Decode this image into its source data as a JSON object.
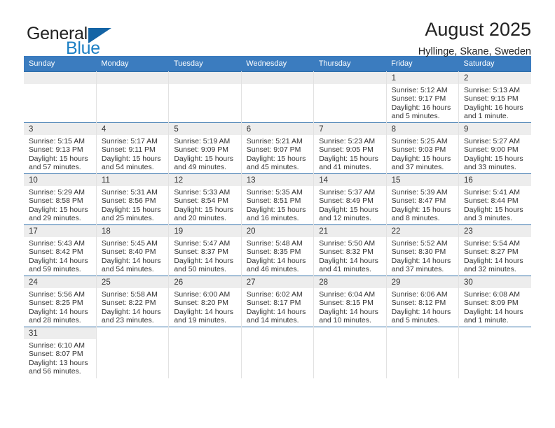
{
  "brand": {
    "name_top": "General",
    "name_bottom": "Blue",
    "triangle_color": "#1464a5",
    "blue_color": "#1c7fc4"
  },
  "header": {
    "title": "August 2025",
    "subtitle": "Hyllinge, Skane, Sweden"
  },
  "theme": {
    "header_blue": "#3b7cbf",
    "row_rule_blue": "#2f6ea8",
    "daynum_band": "#ededed"
  },
  "weekdays": [
    "Sunday",
    "Monday",
    "Tuesday",
    "Wednesday",
    "Thursday",
    "Friday",
    "Saturday"
  ],
  "labels": {
    "sunrise_prefix": "Sunrise:",
    "sunset_prefix": "Sunset:",
    "daylight_prefix": "Daylight:"
  },
  "weeks": [
    [
      {
        "day": "",
        "empty": true
      },
      {
        "day": "",
        "empty": true
      },
      {
        "day": "",
        "empty": true
      },
      {
        "day": "",
        "empty": true
      },
      {
        "day": "",
        "empty": true
      },
      {
        "day": "1",
        "sunrise": "Sunrise: 5:12 AM",
        "sunset": "Sunset: 9:17 PM",
        "daylight_line1": "Daylight: 16 hours",
        "daylight_line2": "and 5 minutes."
      },
      {
        "day": "2",
        "sunrise": "Sunrise: 5:13 AM",
        "sunset": "Sunset: 9:15 PM",
        "daylight_line1": "Daylight: 16 hours",
        "daylight_line2": "and 1 minute."
      }
    ],
    [
      {
        "day": "3",
        "sunrise": "Sunrise: 5:15 AM",
        "sunset": "Sunset: 9:13 PM",
        "daylight_line1": "Daylight: 15 hours",
        "daylight_line2": "and 57 minutes."
      },
      {
        "day": "4",
        "sunrise": "Sunrise: 5:17 AM",
        "sunset": "Sunset: 9:11 PM",
        "daylight_line1": "Daylight: 15 hours",
        "daylight_line2": "and 54 minutes."
      },
      {
        "day": "5",
        "sunrise": "Sunrise: 5:19 AM",
        "sunset": "Sunset: 9:09 PM",
        "daylight_line1": "Daylight: 15 hours",
        "daylight_line2": "and 49 minutes."
      },
      {
        "day": "6",
        "sunrise": "Sunrise: 5:21 AM",
        "sunset": "Sunset: 9:07 PM",
        "daylight_line1": "Daylight: 15 hours",
        "daylight_line2": "and 45 minutes."
      },
      {
        "day": "7",
        "sunrise": "Sunrise: 5:23 AM",
        "sunset": "Sunset: 9:05 PM",
        "daylight_line1": "Daylight: 15 hours",
        "daylight_line2": "and 41 minutes."
      },
      {
        "day": "8",
        "sunrise": "Sunrise: 5:25 AM",
        "sunset": "Sunset: 9:03 PM",
        "daylight_line1": "Daylight: 15 hours",
        "daylight_line2": "and 37 minutes."
      },
      {
        "day": "9",
        "sunrise": "Sunrise: 5:27 AM",
        "sunset": "Sunset: 9:00 PM",
        "daylight_line1": "Daylight: 15 hours",
        "daylight_line2": "and 33 minutes."
      }
    ],
    [
      {
        "day": "10",
        "sunrise": "Sunrise: 5:29 AM",
        "sunset": "Sunset: 8:58 PM",
        "daylight_line1": "Daylight: 15 hours",
        "daylight_line2": "and 29 minutes."
      },
      {
        "day": "11",
        "sunrise": "Sunrise: 5:31 AM",
        "sunset": "Sunset: 8:56 PM",
        "daylight_line1": "Daylight: 15 hours",
        "daylight_line2": "and 25 minutes."
      },
      {
        "day": "12",
        "sunrise": "Sunrise: 5:33 AM",
        "sunset": "Sunset: 8:54 PM",
        "daylight_line1": "Daylight: 15 hours",
        "daylight_line2": "and 20 minutes."
      },
      {
        "day": "13",
        "sunrise": "Sunrise: 5:35 AM",
        "sunset": "Sunset: 8:51 PM",
        "daylight_line1": "Daylight: 15 hours",
        "daylight_line2": "and 16 minutes."
      },
      {
        "day": "14",
        "sunrise": "Sunrise: 5:37 AM",
        "sunset": "Sunset: 8:49 PM",
        "daylight_line1": "Daylight: 15 hours",
        "daylight_line2": "and 12 minutes."
      },
      {
        "day": "15",
        "sunrise": "Sunrise: 5:39 AM",
        "sunset": "Sunset: 8:47 PM",
        "daylight_line1": "Daylight: 15 hours",
        "daylight_line2": "and 8 minutes."
      },
      {
        "day": "16",
        "sunrise": "Sunrise: 5:41 AM",
        "sunset": "Sunset: 8:44 PM",
        "daylight_line1": "Daylight: 15 hours",
        "daylight_line2": "and 3 minutes."
      }
    ],
    [
      {
        "day": "17",
        "sunrise": "Sunrise: 5:43 AM",
        "sunset": "Sunset: 8:42 PM",
        "daylight_line1": "Daylight: 14 hours",
        "daylight_line2": "and 59 minutes."
      },
      {
        "day": "18",
        "sunrise": "Sunrise: 5:45 AM",
        "sunset": "Sunset: 8:40 PM",
        "daylight_line1": "Daylight: 14 hours",
        "daylight_line2": "and 54 minutes."
      },
      {
        "day": "19",
        "sunrise": "Sunrise: 5:47 AM",
        "sunset": "Sunset: 8:37 PM",
        "daylight_line1": "Daylight: 14 hours",
        "daylight_line2": "and 50 minutes."
      },
      {
        "day": "20",
        "sunrise": "Sunrise: 5:48 AM",
        "sunset": "Sunset: 8:35 PM",
        "daylight_line1": "Daylight: 14 hours",
        "daylight_line2": "and 46 minutes."
      },
      {
        "day": "21",
        "sunrise": "Sunrise: 5:50 AM",
        "sunset": "Sunset: 8:32 PM",
        "daylight_line1": "Daylight: 14 hours",
        "daylight_line2": "and 41 minutes."
      },
      {
        "day": "22",
        "sunrise": "Sunrise: 5:52 AM",
        "sunset": "Sunset: 8:30 PM",
        "daylight_line1": "Daylight: 14 hours",
        "daylight_line2": "and 37 minutes."
      },
      {
        "day": "23",
        "sunrise": "Sunrise: 5:54 AM",
        "sunset": "Sunset: 8:27 PM",
        "daylight_line1": "Daylight: 14 hours",
        "daylight_line2": "and 32 minutes."
      }
    ],
    [
      {
        "day": "24",
        "sunrise": "Sunrise: 5:56 AM",
        "sunset": "Sunset: 8:25 PM",
        "daylight_line1": "Daylight: 14 hours",
        "daylight_line2": "and 28 minutes."
      },
      {
        "day": "25",
        "sunrise": "Sunrise: 5:58 AM",
        "sunset": "Sunset: 8:22 PM",
        "daylight_line1": "Daylight: 14 hours",
        "daylight_line2": "and 23 minutes."
      },
      {
        "day": "26",
        "sunrise": "Sunrise: 6:00 AM",
        "sunset": "Sunset: 8:20 PM",
        "daylight_line1": "Daylight: 14 hours",
        "daylight_line2": "and 19 minutes."
      },
      {
        "day": "27",
        "sunrise": "Sunrise: 6:02 AM",
        "sunset": "Sunset: 8:17 PM",
        "daylight_line1": "Daylight: 14 hours",
        "daylight_line2": "and 14 minutes."
      },
      {
        "day": "28",
        "sunrise": "Sunrise: 6:04 AM",
        "sunset": "Sunset: 8:15 PM",
        "daylight_line1": "Daylight: 14 hours",
        "daylight_line2": "and 10 minutes."
      },
      {
        "day": "29",
        "sunrise": "Sunrise: 6:06 AM",
        "sunset": "Sunset: 8:12 PM",
        "daylight_line1": "Daylight: 14 hours",
        "daylight_line2": "and 5 minutes."
      },
      {
        "day": "30",
        "sunrise": "Sunrise: 6:08 AM",
        "sunset": "Sunset: 8:09 PM",
        "daylight_line1": "Daylight: 14 hours",
        "daylight_line2": "and 1 minute."
      }
    ],
    [
      {
        "day": "31",
        "sunrise": "Sunrise: 6:10 AM",
        "sunset": "Sunset: 8:07 PM",
        "daylight_line1": "Daylight: 13 hours",
        "daylight_line2": "and 56 minutes."
      },
      {
        "day": "",
        "blank": true
      },
      {
        "day": "",
        "blank": true
      },
      {
        "day": "",
        "blank": true
      },
      {
        "day": "",
        "blank": true
      },
      {
        "day": "",
        "blank": true
      },
      {
        "day": "",
        "blank": true
      }
    ]
  ]
}
